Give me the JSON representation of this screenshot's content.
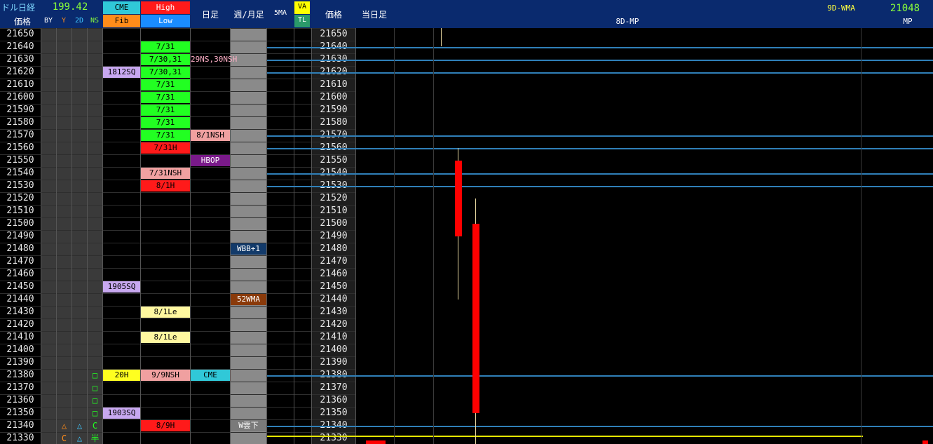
{
  "header": {
    "usd_nikkei_label": "ドル日経",
    "usd_nikkei_value": "199.42",
    "price_label": "価格",
    "col_by": "BY",
    "col_y": "Y",
    "col_2d": "2D",
    "col_ns": "NS",
    "cme_label": "CME",
    "fib_label": "Fib",
    "high_label": "High",
    "low_label": "Low",
    "daily_label": "日足",
    "weekly_monthly_label": "週/月足",
    "wma5_label": "5MA",
    "va_label": "VA",
    "tl_label": "TL",
    "price_label2": "価格",
    "today_label": "当日足",
    "mp8d_label": "8D-MP",
    "wma9d_label": "9D-WMA",
    "wma9d_value": "21048",
    "mp_label": "MP"
  },
  "prices": [
    "21650",
    "21640",
    "21630",
    "21620",
    "21610",
    "21600",
    "21590",
    "21580",
    "21570",
    "21560",
    "21550",
    "21540",
    "21530",
    "21520",
    "21510",
    "21500",
    "21490",
    "21480",
    "21470",
    "21460",
    "21450",
    "21440",
    "21430",
    "21420",
    "21410",
    "21400",
    "21390",
    "21380",
    "21370",
    "21360",
    "21350",
    "21340",
    "21330"
  ],
  "fib_labels": [
    {
      "row": 3,
      "text": "1812SQ"
    },
    {
      "row": 20,
      "text": "1905SQ"
    },
    {
      "row": 27,
      "text": "20H"
    },
    {
      "row": 30,
      "text": "1903SQ"
    }
  ],
  "highlow_labels": [
    {
      "row": 1,
      "text": "7/31",
      "kind": "low"
    },
    {
      "row": 2,
      "text": "7/30,31",
      "kind": "low"
    },
    {
      "row": 3,
      "text": "7/30,31",
      "kind": "low"
    },
    {
      "row": 4,
      "text": "7/31",
      "kind": "low"
    },
    {
      "row": 5,
      "text": "7/31",
      "kind": "low"
    },
    {
      "row": 6,
      "text": "7/31",
      "kind": "low"
    },
    {
      "row": 7,
      "text": "7/31",
      "kind": "low"
    },
    {
      "row": 8,
      "text": "7/31",
      "kind": "low"
    },
    {
      "row": 9,
      "text": "7/31H",
      "kind": "high"
    },
    {
      "row": 11,
      "text": "7/31NSH",
      "kind": "pink"
    },
    {
      "row": 12,
      "text": "8/1H",
      "kind": "high"
    },
    {
      "row": 22,
      "text": "8/1Le",
      "kind": "yellow"
    },
    {
      "row": 24,
      "text": "8/1Le",
      "kind": "yellow"
    },
    {
      "row": 27,
      "text": "9/9NSH",
      "kind": "pink"
    },
    {
      "row": 31,
      "text": "8/9H",
      "kind": "high"
    }
  ],
  "daily_labels": [
    {
      "row": 2,
      "text": "29NS,30NSH",
      "kind": "pinktext"
    },
    {
      "row": 8,
      "text": "8/1NSH",
      "kind": "pink"
    },
    {
      "row": 10,
      "text": "HBOP",
      "kind": "purple"
    },
    {
      "row": 27,
      "text": "CME",
      "kind": "cyan"
    }
  ],
  "weekly_labels": [
    {
      "row": 17,
      "text": "WBB+1",
      "kind": "navy"
    },
    {
      "row": 21,
      "text": "52WMA",
      "kind": "brown"
    },
    {
      "row": 31,
      "text": "W雲下",
      "kind": "gray"
    }
  ],
  "ns_marks": [
    {
      "row": 27,
      "text": "□"
    },
    {
      "row": 28,
      "text": "□"
    },
    {
      "row": 29,
      "text": "□"
    },
    {
      "row": 30,
      "text": "□"
    },
    {
      "row": 31,
      "text": "C"
    },
    {
      "row": 32,
      "text": "半"
    }
  ],
  "y_marks": [
    {
      "row": 31,
      "text": "△",
      "color": "#ff8c1a"
    },
    {
      "row": 32,
      "text": "C",
      "color": "#ff8c1a"
    }
  ],
  "d2_marks": [
    {
      "row": 31,
      "text": "△",
      "color": "#40c8ff"
    },
    {
      "row": 32,
      "text": "△",
      "color": "#40c8ff"
    }
  ],
  "colors": {
    "header_bg": "#0a2a6e",
    "low_green": "#22ff22",
    "high_red": "#ff1a1a",
    "fib_lavender": "#c8a8f0",
    "pink": "#f0a0a0",
    "cyan": "#30c8d8",
    "yellow_label": "#fff8a0",
    "candle_red": "#ff0000",
    "level_line": "#2f7fb8",
    "va_line": "#e6e600"
  },
  "chart_data": {
    "type": "candlestick",
    "ylim": [
      21325,
      21655
    ],
    "level_lines": [
      21640,
      21630,
      21620,
      21570,
      21560,
      21540,
      21530,
      21380,
      21340
    ],
    "value_area_line": 21332,
    "candles": [
      {
        "open": 21550,
        "close": 21490,
        "high": 21560,
        "low": 21440
      },
      {
        "open": 21500,
        "close": 21350,
        "high": 21520,
        "low": 21320
      }
    ]
  }
}
